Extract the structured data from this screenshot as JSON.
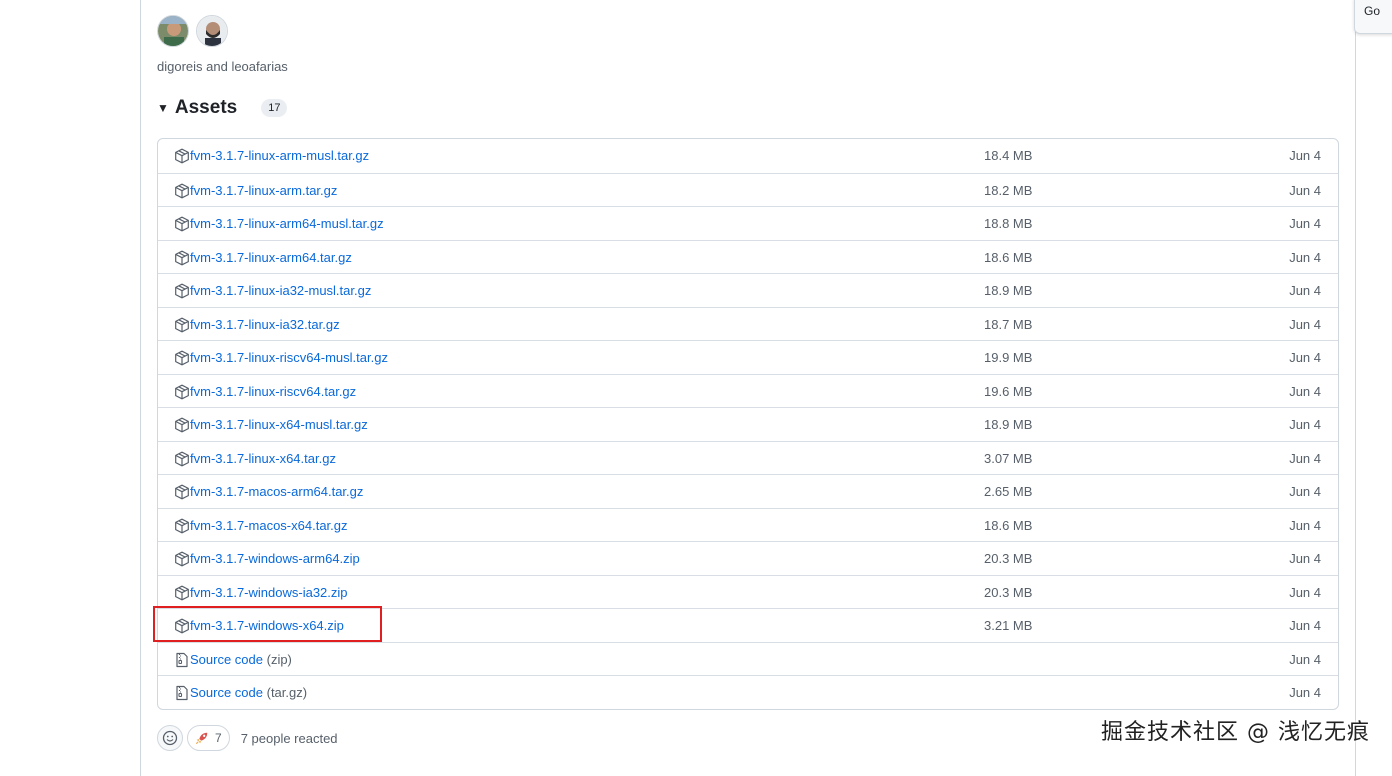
{
  "contributors": "digoreis and leoafarias",
  "assets": {
    "title": "Assets",
    "count": "17",
    "rows": [
      {
        "name": "fvm-3.1.7-linux-arm-musl.tar.gz",
        "suffix": "",
        "size": "18.4 MB",
        "date": "Jun 4",
        "icon": "package-icon"
      },
      {
        "name": "fvm-3.1.7-linux-arm.tar.gz",
        "suffix": "",
        "size": "18.2 MB",
        "date": "Jun 4",
        "icon": "package-icon"
      },
      {
        "name": "fvm-3.1.7-linux-arm64-musl.tar.gz",
        "suffix": "",
        "size": "18.8 MB",
        "date": "Jun 4",
        "icon": "package-icon"
      },
      {
        "name": "fvm-3.1.7-linux-arm64.tar.gz",
        "suffix": "",
        "size": "18.6 MB",
        "date": "Jun 4",
        "icon": "package-icon"
      },
      {
        "name": "fvm-3.1.7-linux-ia32-musl.tar.gz",
        "suffix": "",
        "size": "18.9 MB",
        "date": "Jun 4",
        "icon": "package-icon"
      },
      {
        "name": "fvm-3.1.7-linux-ia32.tar.gz",
        "suffix": "",
        "size": "18.7 MB",
        "date": "Jun 4",
        "icon": "package-icon"
      },
      {
        "name": "fvm-3.1.7-linux-riscv64-musl.tar.gz",
        "suffix": "",
        "size": "19.9 MB",
        "date": "Jun 4",
        "icon": "package-icon"
      },
      {
        "name": "fvm-3.1.7-linux-riscv64.tar.gz",
        "suffix": "",
        "size": "19.6 MB",
        "date": "Jun 4",
        "icon": "package-icon"
      },
      {
        "name": "fvm-3.1.7-linux-x64-musl.tar.gz",
        "suffix": "",
        "size": "18.9 MB",
        "date": "Jun 4",
        "icon": "package-icon"
      },
      {
        "name": "fvm-3.1.7-linux-x64.tar.gz",
        "suffix": "",
        "size": "3.07 MB",
        "date": "Jun 4",
        "icon": "package-icon"
      },
      {
        "name": "fvm-3.1.7-macos-arm64.tar.gz",
        "suffix": "",
        "size": "2.65 MB",
        "date": "Jun 4",
        "icon": "package-icon"
      },
      {
        "name": "fvm-3.1.7-macos-x64.tar.gz",
        "suffix": "",
        "size": "18.6 MB",
        "date": "Jun 4",
        "icon": "package-icon"
      },
      {
        "name": "fvm-3.1.7-windows-arm64.zip",
        "suffix": "",
        "size": "20.3 MB",
        "date": "Jun 4",
        "icon": "package-icon"
      },
      {
        "name": "fvm-3.1.7-windows-ia32.zip",
        "suffix": "",
        "size": "20.3 MB",
        "date": "Jun 4",
        "icon": "package-icon"
      },
      {
        "name": "fvm-3.1.7-windows-x64.zip",
        "suffix": "",
        "size": "3.21 MB",
        "date": "Jun 4",
        "icon": "package-icon"
      },
      {
        "name": "Source code",
        "suffix": " (zip)",
        "size": "",
        "date": "Jun 4",
        "icon": "file-zip-icon"
      },
      {
        "name": "Source code",
        "suffix": " (tar.gz)",
        "size": "",
        "date": "Jun 4",
        "icon": "file-zip-icon"
      }
    ]
  },
  "reactions": {
    "rocket_count": "7",
    "summary": "7 people reacted"
  },
  "corner_button_label": "Go",
  "watermark": "掘金技术社区 @ 浅忆无痕",
  "colors": {
    "link": "#0969da",
    "muted": "#57606a",
    "border": "#d0d7de",
    "highlight": "#e02020"
  }
}
